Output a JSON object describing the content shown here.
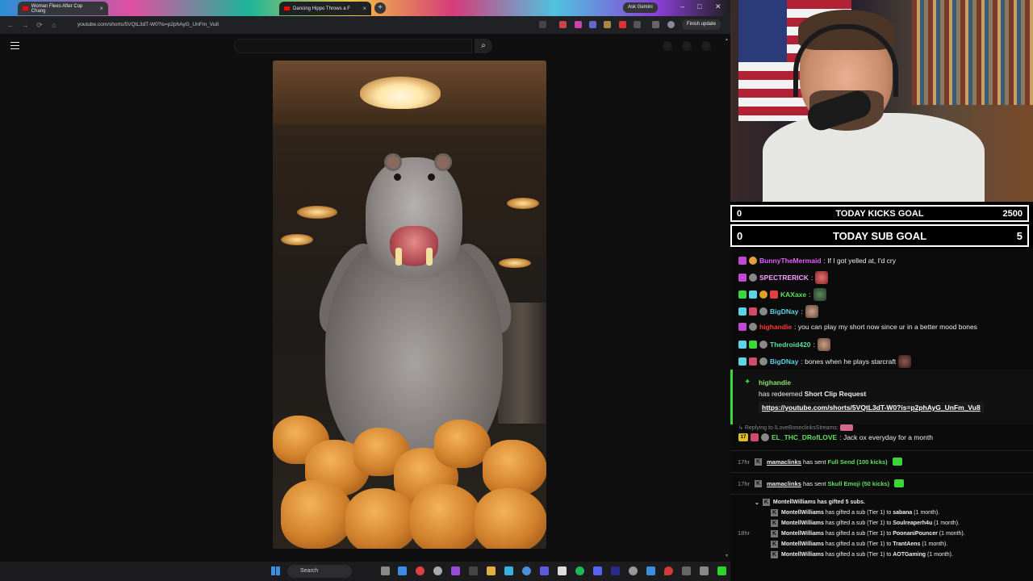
{
  "browser": {
    "tabs": [
      {
        "title": "Woman Flees After Cop Chang",
        "active": false
      },
      {
        "title": "Dancing Hippo Throws a F",
        "active": true
      }
    ],
    "ask_button": "Ask Gemini",
    "url": "youtube.com/shorts/5VQtL3dT-W0?is=p2phAyG_UnFm_Vu8",
    "finish_update": "Finish update"
  },
  "goals": {
    "kicks": {
      "current": "0",
      "title": "TODAY KICKS GOAL",
      "target": "2500"
    },
    "subs": {
      "current": "0",
      "title": "TODAY SUB GOAL",
      "target": "5"
    }
  },
  "chat": {
    "messages": [
      {
        "user": "BunnyTheMermaid",
        "text": ": If I got yelled at, I'd cry",
        "color": "#e060ff"
      },
      {
        "user": "SPECTRERICK",
        "text": ":",
        "color": "#ff9cff"
      },
      {
        "user": "KAXaxe",
        "text": ":",
        "color": "#5ee05e"
      },
      {
        "user": "BigDNay",
        "text": ":",
        "color": "#5fd3e6"
      },
      {
        "user": "highandie",
        "text": ": you can play my short now since ur in a better mood bones",
        "color": "#ff3a3a"
      },
      {
        "user": "Thedroid420",
        "text": ":",
        "color": "#5ee0a0"
      },
      {
        "user": "BigDNay",
        "text": ": bones when he plays starcraft",
        "color": "#5fd3e6"
      }
    ],
    "redeem": {
      "user": "highandie",
      "action_prefix": "has redeemed ",
      "reward": "Short Clip Request",
      "link": "https://youtube.com/shorts/5VQtL3dT-W0?is=p2phAyG_UnFm_Vu8"
    },
    "reply_to": "Replying to ILoveBoneclinksStreams:",
    "reply_msg": {
      "badge": "17",
      "user": "EL_THC_DRofLOVE",
      "text": ": Jack ox everyday for a month",
      "color": "#5ee05e"
    },
    "events": [
      {
        "time": "17hr",
        "who": "mamaclinks",
        "action": "has sent ",
        "item": "Full Send (100 kicks)"
      },
      {
        "time": "17hr",
        "who": "mamaclinks",
        "action": "has sent ",
        "item": "Skull Emoji (50 kicks)"
      }
    ],
    "gift": {
      "time": "18hr",
      "header": "MontellWilliams has gifted 5 subs.",
      "lines": [
        {
          "who": "MontellWilliams",
          "mid": "has gifted a sub (Tier 1) to ",
          "to": "sabana",
          "tail": " (1 month)."
        },
        {
          "who": "MontellWilliams",
          "mid": "has gifted a sub (Tier 1) to ",
          "to": "Soulreaperh4u",
          "tail": " (1 month)."
        },
        {
          "who": "MontellWilliams",
          "mid": "has gifted a sub (Tier 1) to ",
          "to": "PoonaniPouncer",
          "tail": " (1 month)."
        },
        {
          "who": "MontellWilliams",
          "mid": "has gifted a sub (Tier 1) to ",
          "to": "TrantAens",
          "tail": " (1 month)."
        },
        {
          "who": "MontellWilliams",
          "mid": "has gifted a sub (Tier 1) to ",
          "to": "AOTGaming",
          "tail": " (1 month)."
        }
      ]
    }
  },
  "taskbar": {
    "search_placeholder": "Search"
  }
}
